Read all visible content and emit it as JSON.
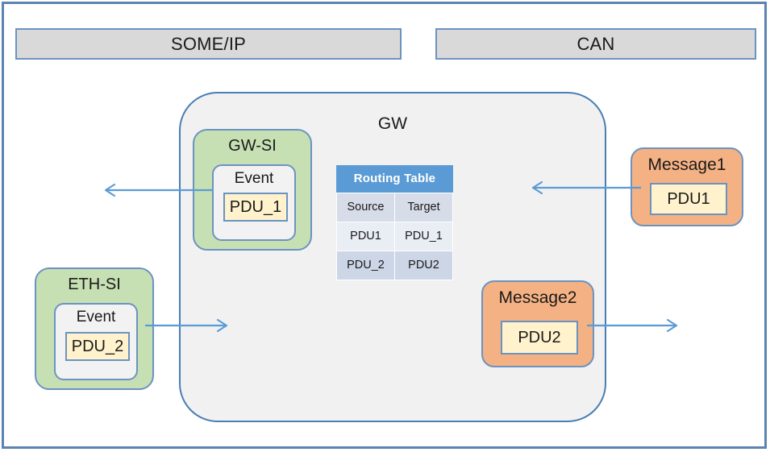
{
  "diagram": {
    "title": "GW",
    "banners": [
      {
        "id": "someip",
        "label": "SOME/IP"
      },
      {
        "id": "can",
        "label": "CAN"
      }
    ],
    "gateway": {
      "label": "GW",
      "service_interfaces": [
        {
          "id": "gw-si",
          "label": "GW-SI",
          "event_label": "Event",
          "pdu_label": "PDU_1"
        }
      ],
      "routing_table": {
        "title": "Routing Table",
        "columns": [
          "Source",
          "Target"
        ],
        "rows": [
          {
            "source": "PDU1",
            "target": "PDU_1"
          },
          {
            "source": "PDU_2",
            "target": "PDU2"
          }
        ]
      }
    },
    "eth_interface": {
      "id": "eth-si",
      "label": "ETH-SI",
      "event_label": "Event",
      "pdu_label": "PDU_2"
    },
    "messages": [
      {
        "id": "message1",
        "label": "Message1",
        "pdu_label": "PDU1"
      },
      {
        "id": "message2",
        "label": "Message2",
        "pdu_label": "PDU2"
      }
    ],
    "colors": {
      "banner_fill": "#D9D9D9",
      "frame_border": "#5B84B1",
      "gateway_fill": "#F1F1F1",
      "gateway_border": "#4A7EB5",
      "service_interface_fill": "#C6E0B4",
      "message_fill": "#F4B183",
      "pdu_fill": "#FFF2CC",
      "table_header_fill": "#5B9BD5",
      "table_row_light": "#E9EDF4",
      "table_row_dark": "#CDD6E6",
      "arrow_stroke": "#5B9BD5"
    }
  }
}
